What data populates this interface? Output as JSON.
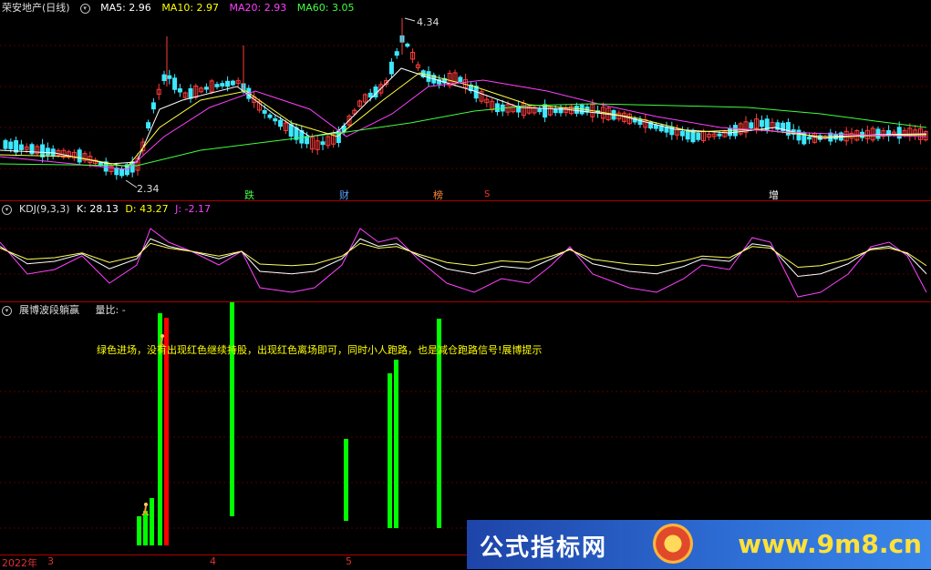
{
  "main_header": {
    "title": "荣安地产(日线)",
    "ma5": "MA5: 2.96",
    "ma10": "MA10: 2.97",
    "ma20": "MA20: 2.93",
    "ma60": "MA60: 3.05",
    "colors": {
      "ma5": "#ffffff",
      "ma10": "#ffff00",
      "ma20": "#ff40ff",
      "ma60": "#40ff40"
    }
  },
  "price_labels": {
    "high": "4.34",
    "low": "2.34"
  },
  "event_markers": [
    {
      "text": "跌",
      "color": "#40ff40"
    },
    {
      "text": "财",
      "color": "#5aa0ff"
    },
    {
      "text": "榜",
      "color": "#ff8a3a"
    },
    {
      "text": "S",
      "color": "#ff3030"
    },
    {
      "text": "增",
      "color": "#ffffff"
    }
  ],
  "kdj_header": {
    "name": "KDJ(9,3,3)",
    "k": "K: 28.13",
    "d": "D: 43.27",
    "j": "J: -2.17"
  },
  "indicator_header": {
    "name": "展博波段躺赢",
    "ratio": "量比: -"
  },
  "indicator_note": "绿色进场，没有出现红色继续持股，出现红色离场即可，同时小人跑路，也是减仓跑路信号!展博提示",
  "x_axis": [
    "2022年",
    "3",
    "4",
    "5"
  ],
  "watermark": {
    "left": "公式指标网",
    "right": "www.9m8.cn"
  },
  "chart_data": {
    "type": "bar",
    "title": "展博波段躺赢",
    "series": [
      {
        "color": "#00ff00",
        "values": [
          32,
          38,
          52,
          255,
          250,
          90,
          170,
          185,
          230
        ]
      },
      {
        "color": "#ff0000",
        "values": [
          250
        ]
      }
    ]
  }
}
